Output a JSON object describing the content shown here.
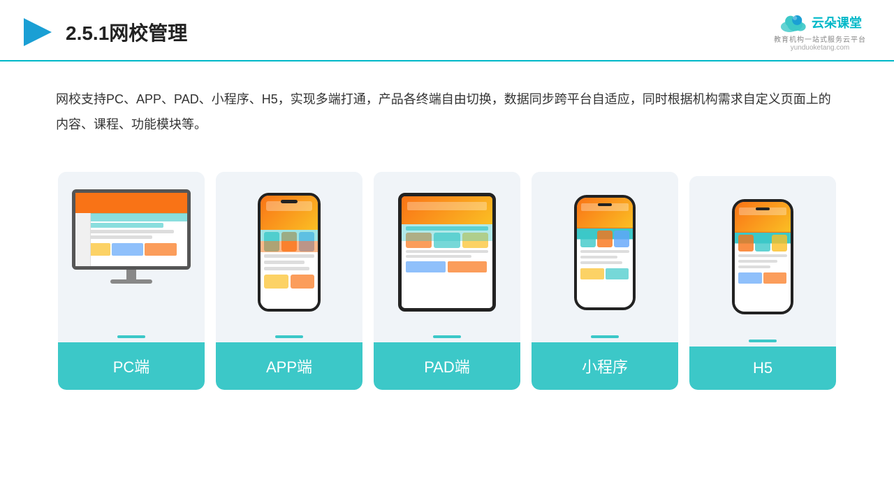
{
  "header": {
    "title": "2.5.1网校管理",
    "logo": {
      "brand": "云朵课堂",
      "domain": "yunduoketang.com",
      "tagline": "教育机构一站式服务云平台"
    }
  },
  "description": "网校支持PC、APP、PAD、小程序、H5，实现多端打通，产品各终端自由切换，数据同步跨平台自适应，同时根据机构需求自定义页面上的内容、课程、功能模块等。",
  "cards": [
    {
      "id": "pc",
      "label": "PC端"
    },
    {
      "id": "app",
      "label": "APP端"
    },
    {
      "id": "pad",
      "label": "PAD端"
    },
    {
      "id": "miniapp",
      "label": "小程序"
    },
    {
      "id": "h5",
      "label": "H5"
    }
  ],
  "accent_color": "#3cc8c8"
}
